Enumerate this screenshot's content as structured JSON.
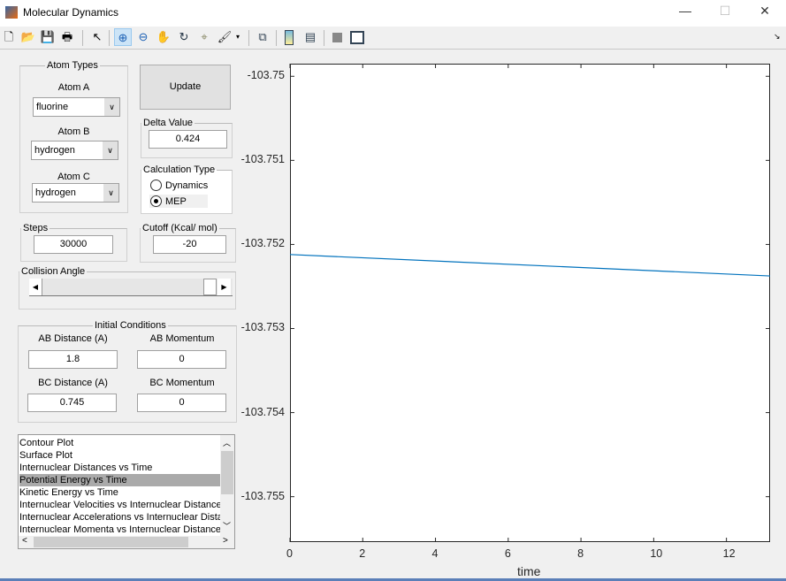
{
  "window": {
    "title": "Molecular Dynamics",
    "minimize": "—",
    "maximize": "☐",
    "close": "✕"
  },
  "toolbar": {
    "icons": [
      "new-figure-icon",
      "open-icon",
      "save-icon",
      "print-icon",
      "pointer-icon",
      "zoom-in-icon",
      "zoom-out-icon",
      "pan-icon",
      "rotate-icon",
      "data-cursor-icon",
      "brush-icon",
      "link-icon",
      "colorbar-icon",
      "legend-icon",
      "hide-plot-tools-icon",
      "show-plot-tools-icon"
    ]
  },
  "atom_types": {
    "legend": "Atom Types",
    "atom_a_label": "Atom A",
    "atom_a": "fluorine",
    "atom_b_label": "Atom B",
    "atom_b": "hydrogen",
    "atom_c_label": "Atom C",
    "atom_c": "hydrogen"
  },
  "update_label": "Update",
  "delta": {
    "legend": "Delta Value",
    "value": "0.424"
  },
  "calc_type": {
    "legend": "Calculation Type",
    "options": [
      "Dynamics",
      "MEP"
    ],
    "selected": "MEP"
  },
  "steps": {
    "legend": "Steps",
    "value": "30000"
  },
  "cutoff": {
    "legend": "Cutoff (Kcal/ mol)",
    "value": "-20"
  },
  "collision": {
    "legend": "Collision Angle",
    "slider_value": 1.0
  },
  "initial": {
    "legend": "Initial Conditions",
    "ab_dist_label": "AB Distance (A)",
    "ab_dist": "1.8",
    "ab_mom_label": "AB Momentum",
    "ab_mom": "0",
    "bc_dist_label": "BC Distance (A)",
    "bc_dist": "0.745",
    "bc_mom_label": "BC Momentum",
    "bc_mom": "0"
  },
  "plot_list": {
    "items": [
      "Contour Plot",
      "Surface Plot",
      "Internuclear Distances vs Time",
      "Potential Energy vs Time",
      "Kinetic Energy vs Time",
      "Internuclear Velocities vs Internuclear Distance",
      "Internuclear Accelerations vs Internuclear Distance",
      "Internuclear Momenta vs Internuclear Distance"
    ],
    "selected_index": 3
  },
  "chart_data": {
    "type": "line",
    "xlabel": "time",
    "ylabel": "",
    "xlim": [
      0,
      13.2
    ],
    "ylim": [
      -103.75554,
      -103.74985
    ],
    "xticks": [
      "0",
      "2",
      "4",
      "6",
      "8",
      "10",
      "12"
    ],
    "xtick_values": [
      0,
      2,
      4,
      6,
      8,
      10,
      12
    ],
    "yticks": [
      "-103.75",
      "-103.751",
      "-103.752",
      "-103.753",
      "-103.754",
      "-103.755"
    ],
    "ytick_values": [
      -103.75,
      -103.751,
      -103.752,
      -103.753,
      -103.754,
      -103.755
    ],
    "series": [
      {
        "x": [
          0,
          13.2
        ],
        "y": [
          -103.75212,
          -103.752375
        ],
        "color": "#0072bd"
      }
    ],
    "grid": false
  }
}
